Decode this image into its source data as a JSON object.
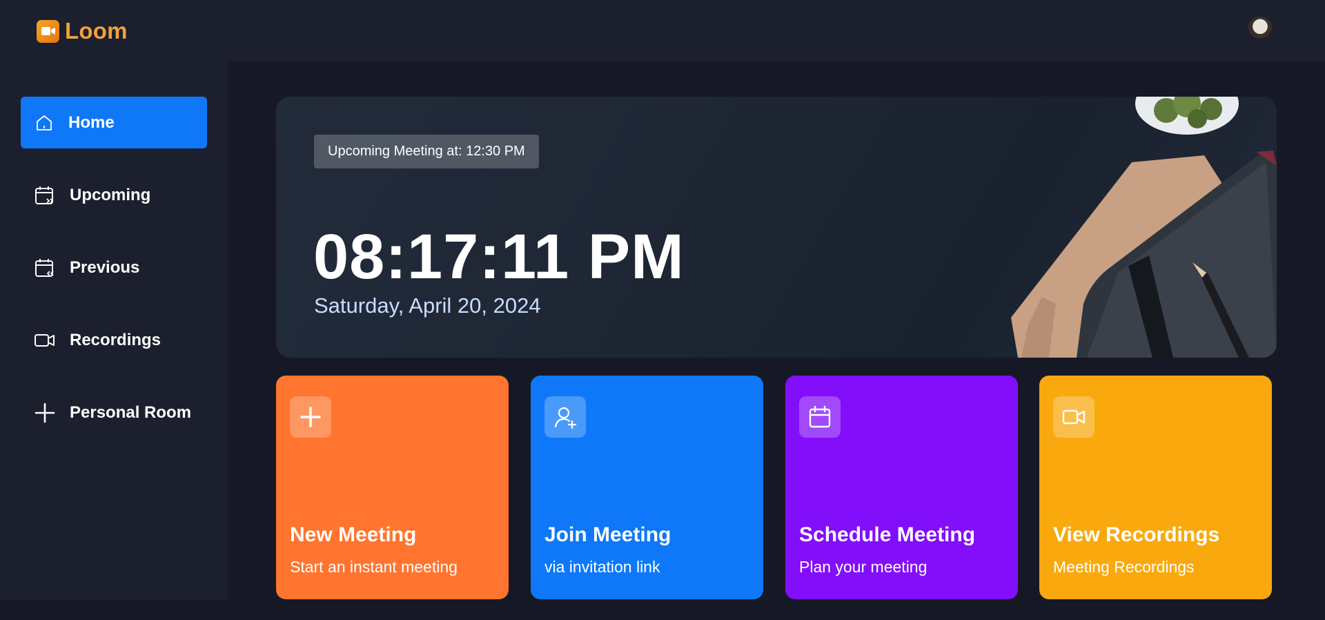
{
  "app": {
    "name": "Loom"
  },
  "sidebar": {
    "items": [
      {
        "label": "Home",
        "icon": "home-icon",
        "active": true
      },
      {
        "label": "Upcoming",
        "icon": "calendar-forward-icon",
        "active": false
      },
      {
        "label": "Previous",
        "icon": "calendar-back-icon",
        "active": false
      },
      {
        "label": "Recordings",
        "icon": "video-icon",
        "active": false
      },
      {
        "label": "Personal Room",
        "icon": "plus-icon",
        "active": false
      }
    ]
  },
  "hero": {
    "badge": "Upcoming Meeting at: 12:30 PM",
    "time": "08:17:11 PM",
    "date": "Saturday, April 20, 2024"
  },
  "cards": [
    {
      "title": "New Meeting",
      "subtitle": "Start an instant meeting",
      "icon": "plus-icon",
      "color": "#ff742e"
    },
    {
      "title": "Join Meeting",
      "subtitle": "via invitation link",
      "icon": "user-add-icon",
      "color": "#0e78f9"
    },
    {
      "title": "Schedule Meeting",
      "subtitle": "Plan your meeting",
      "icon": "calendar-icon",
      "color": "#830ef9"
    },
    {
      "title": "View Recordings",
      "subtitle": "Meeting Recordings",
      "icon": "video-icon",
      "color": "#f9a90e"
    }
  ],
  "colors": {
    "background": "#161925",
    "panel": "#1c1f2e",
    "accent": "#0e78f9",
    "brand": "#f2a23a"
  }
}
